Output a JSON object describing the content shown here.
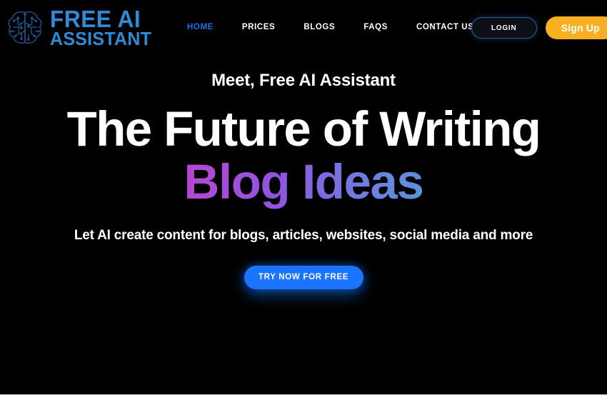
{
  "brand": {
    "icon": "brain-circuit-icon",
    "line1": "FREE AI",
    "line2": "ASSISTANT",
    "color": "#2f8ad8"
  },
  "nav": {
    "items": [
      {
        "label": "HOME",
        "active": true
      },
      {
        "label": "PRICES",
        "active": false
      },
      {
        "label": "BLOGS",
        "active": false
      },
      {
        "label": "FAQS",
        "active": false
      },
      {
        "label": "CONTACT US",
        "active": false
      }
    ],
    "active_color": "#1a6ef5",
    "inactive_color": "#ffffff"
  },
  "header_actions": {
    "login_label": "LOGIN",
    "signup_label": "Sign Up",
    "login_border_color": "#2e5d96",
    "signup_bg": "#f7b021"
  },
  "hero": {
    "eyebrow": "Meet, Free AI Assistant",
    "title": "The Future of Writing",
    "title_accent": "Blog Ideas",
    "subtitle": "Let AI create content for blogs, articles, websites, social media and more",
    "cta_label": "TRY NOW FOR FREE",
    "cta_bg": "#1a74ff",
    "gradient_start": "#e0499f",
    "gradient_mid": "#8f55e0",
    "gradient_end": "#35c0c0",
    "background": "#000000"
  }
}
